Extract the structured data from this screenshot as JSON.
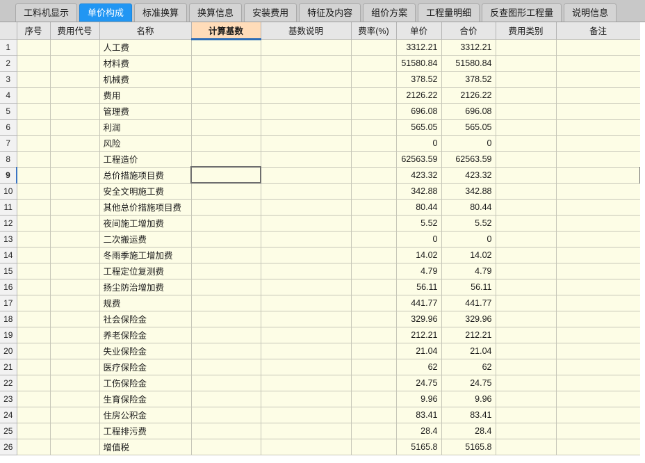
{
  "tabs": [
    {
      "label": "工料机显示",
      "active": false
    },
    {
      "label": "单价构成",
      "active": true
    },
    {
      "label": "标准换算",
      "active": false
    },
    {
      "label": "换算信息",
      "active": false
    },
    {
      "label": "安装费用",
      "active": false
    },
    {
      "label": "特征及内容",
      "active": false
    },
    {
      "label": "组价方案",
      "active": false
    },
    {
      "label": "工程量明细",
      "active": false
    },
    {
      "label": "反查图形工程量",
      "active": false
    },
    {
      "label": "说明信息",
      "active": false
    }
  ],
  "grid": {
    "columns": [
      {
        "key": "seq",
        "label": "序号",
        "align": "center",
        "highlighted": false
      },
      {
        "key": "code",
        "label": "费用代号",
        "align": "center",
        "highlighted": false
      },
      {
        "key": "name",
        "label": "名称",
        "align": "center",
        "highlighted": false
      },
      {
        "key": "base",
        "label": "计算基数",
        "align": "center",
        "highlighted": true
      },
      {
        "key": "base_desc",
        "label": "基数说明",
        "align": "center",
        "highlighted": false
      },
      {
        "key": "rate",
        "label": "费率(%)",
        "align": "center",
        "highlighted": false
      },
      {
        "key": "unit_price",
        "label": "单价",
        "align": "center",
        "highlighted": false
      },
      {
        "key": "total",
        "label": "合价",
        "align": "center",
        "highlighted": false
      },
      {
        "key": "fee_type",
        "label": "费用类别",
        "align": "center",
        "highlighted": false
      },
      {
        "key": "remark",
        "label": "备注",
        "align": "center",
        "highlighted": false
      }
    ],
    "selected_row": 9,
    "active_cell_column": "base",
    "rows": [
      {
        "n": "1",
        "seq": "",
        "code": "",
        "name": "人工费",
        "base": "",
        "base_desc": "",
        "rate": "",
        "unit_price": "3312.21",
        "total": "3312.21",
        "fee_type": "",
        "remark": ""
      },
      {
        "n": "2",
        "seq": "",
        "code": "",
        "name": "材料费",
        "base": "",
        "base_desc": "",
        "rate": "",
        "unit_price": "51580.84",
        "total": "51580.84",
        "fee_type": "",
        "remark": ""
      },
      {
        "n": "3",
        "seq": "",
        "code": "",
        "name": "机械费",
        "base": "",
        "base_desc": "",
        "rate": "",
        "unit_price": "378.52",
        "total": "378.52",
        "fee_type": "",
        "remark": ""
      },
      {
        "n": "4",
        "seq": "",
        "code": "",
        "name": "费用",
        "base": "",
        "base_desc": "",
        "rate": "",
        "unit_price": "2126.22",
        "total": "2126.22",
        "fee_type": "",
        "remark": ""
      },
      {
        "n": "5",
        "seq": "",
        "code": "",
        "name": "管理费",
        "base": "",
        "base_desc": "",
        "rate": "",
        "unit_price": "696.08",
        "total": "696.08",
        "fee_type": "",
        "remark": ""
      },
      {
        "n": "6",
        "seq": "",
        "code": "",
        "name": "利润",
        "base": "",
        "base_desc": "",
        "rate": "",
        "unit_price": "565.05",
        "total": "565.05",
        "fee_type": "",
        "remark": ""
      },
      {
        "n": "7",
        "seq": "",
        "code": "",
        "name": "风险",
        "base": "",
        "base_desc": "",
        "rate": "",
        "unit_price": "0",
        "total": "0",
        "fee_type": "",
        "remark": ""
      },
      {
        "n": "8",
        "seq": "",
        "code": "",
        "name": "工程造价",
        "base": "",
        "base_desc": "",
        "rate": "",
        "unit_price": "62563.59",
        "total": "62563.59",
        "fee_type": "",
        "remark": ""
      },
      {
        "n": "9",
        "seq": "",
        "code": "",
        "name": "总价措施项目费",
        "base": "",
        "base_desc": "",
        "rate": "",
        "unit_price": "423.32",
        "total": "423.32",
        "fee_type": "",
        "remark": ""
      },
      {
        "n": "10",
        "seq": "",
        "code": "",
        "name": "安全文明施工费",
        "base": "",
        "base_desc": "",
        "rate": "",
        "unit_price": "342.88",
        "total": "342.88",
        "fee_type": "",
        "remark": ""
      },
      {
        "n": "11",
        "seq": "",
        "code": "",
        "name": "其他总价措施项目费",
        "base": "",
        "base_desc": "",
        "rate": "",
        "unit_price": "80.44",
        "total": "80.44",
        "fee_type": "",
        "remark": ""
      },
      {
        "n": "12",
        "seq": "",
        "code": "",
        "name": "夜间施工增加费",
        "base": "",
        "base_desc": "",
        "rate": "",
        "unit_price": "5.52",
        "total": "5.52",
        "fee_type": "",
        "remark": ""
      },
      {
        "n": "13",
        "seq": "",
        "code": "",
        "name": "二次搬运费",
        "base": "",
        "base_desc": "",
        "rate": "",
        "unit_price": "0",
        "total": "0",
        "fee_type": "",
        "remark": ""
      },
      {
        "n": "14",
        "seq": "",
        "code": "",
        "name": "冬雨季施工增加费",
        "base": "",
        "base_desc": "",
        "rate": "",
        "unit_price": "14.02",
        "total": "14.02",
        "fee_type": "",
        "remark": ""
      },
      {
        "n": "15",
        "seq": "",
        "code": "",
        "name": "工程定位复测费",
        "base": "",
        "base_desc": "",
        "rate": "",
        "unit_price": "4.79",
        "total": "4.79",
        "fee_type": "",
        "remark": ""
      },
      {
        "n": "16",
        "seq": "",
        "code": "",
        "name": "扬尘防治增加费",
        "base": "",
        "base_desc": "",
        "rate": "",
        "unit_price": "56.11",
        "total": "56.11",
        "fee_type": "",
        "remark": ""
      },
      {
        "n": "17",
        "seq": "",
        "code": "",
        "name": "规费",
        "base": "",
        "base_desc": "",
        "rate": "",
        "unit_price": "441.77",
        "total": "441.77",
        "fee_type": "",
        "remark": ""
      },
      {
        "n": "18",
        "seq": "",
        "code": "",
        "name": "社会保险金",
        "base": "",
        "base_desc": "",
        "rate": "",
        "unit_price": "329.96",
        "total": "329.96",
        "fee_type": "",
        "remark": ""
      },
      {
        "n": "19",
        "seq": "",
        "code": "",
        "name": "养老保险金",
        "base": "",
        "base_desc": "",
        "rate": "",
        "unit_price": "212.21",
        "total": "212.21",
        "fee_type": "",
        "remark": ""
      },
      {
        "n": "20",
        "seq": "",
        "code": "",
        "name": "失业保险金",
        "base": "",
        "base_desc": "",
        "rate": "",
        "unit_price": "21.04",
        "total": "21.04",
        "fee_type": "",
        "remark": ""
      },
      {
        "n": "21",
        "seq": "",
        "code": "",
        "name": "医疗保险金",
        "base": "",
        "base_desc": "",
        "rate": "",
        "unit_price": "62",
        "total": "62",
        "fee_type": "",
        "remark": ""
      },
      {
        "n": "22",
        "seq": "",
        "code": "",
        "name": "工伤保险金",
        "base": "",
        "base_desc": "",
        "rate": "",
        "unit_price": "24.75",
        "total": "24.75",
        "fee_type": "",
        "remark": ""
      },
      {
        "n": "23",
        "seq": "",
        "code": "",
        "name": "生育保险金",
        "base": "",
        "base_desc": "",
        "rate": "",
        "unit_price": "9.96",
        "total": "9.96",
        "fee_type": "",
        "remark": ""
      },
      {
        "n": "24",
        "seq": "",
        "code": "",
        "name": "住房公积金",
        "base": "",
        "base_desc": "",
        "rate": "",
        "unit_price": "83.41",
        "total": "83.41",
        "fee_type": "",
        "remark": ""
      },
      {
        "n": "25",
        "seq": "",
        "code": "",
        "name": "工程排污费",
        "base": "",
        "base_desc": "",
        "rate": "",
        "unit_price": "28.4",
        "total": "28.4",
        "fee_type": "",
        "remark": ""
      },
      {
        "n": "26",
        "seq": "",
        "code": "",
        "name": "增值税",
        "base": "",
        "base_desc": "",
        "rate": "",
        "unit_price": "5165.8",
        "total": "5165.8",
        "fee_type": "",
        "remark": ""
      }
    ]
  },
  "colors": {
    "tab_active_bg": "#2196f3",
    "tab_bg": "#d4d4d4",
    "tabbar_bg": "#c8c8c8",
    "header_bg": "#e6e6e6",
    "header_highlight_bg": "#ffdcb9",
    "header_highlight_underline": "#2d6cb5",
    "cell_bg": "#fdfde6",
    "selected_row_bg": "#b6d7f4",
    "rownum_bg": "#f2f2f2"
  }
}
